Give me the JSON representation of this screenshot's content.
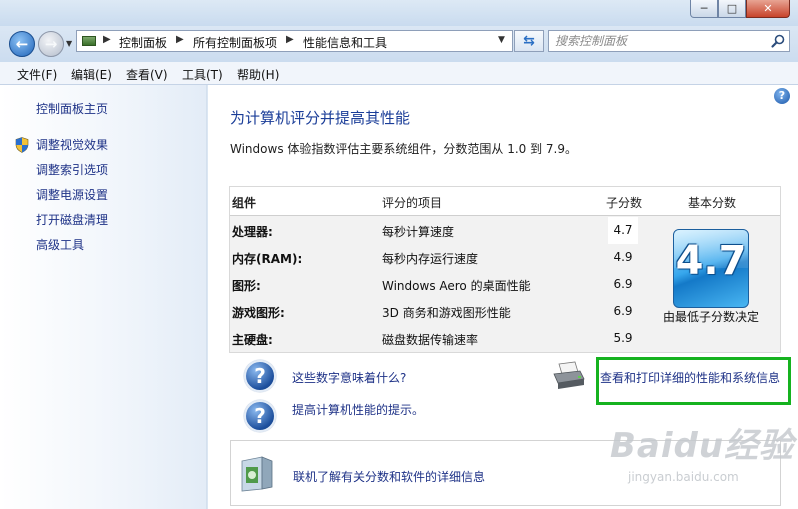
{
  "window": {
    "minimize": "─",
    "maximize": "□",
    "close": "✕"
  },
  "address": {
    "crumbs": [
      "控制面板",
      "所有控制面板项",
      "性能信息和工具"
    ]
  },
  "search": {
    "placeholder": "搜索控制面板"
  },
  "menu": [
    "文件(F)",
    "编辑(E)",
    "查看(V)",
    "工具(T)",
    "帮助(H)"
  ],
  "sidebar": {
    "home": "控制面板主页",
    "items": [
      "调整视觉效果",
      "调整索引选项",
      "调整电源设置",
      "打开磁盘清理",
      "高级工具"
    ]
  },
  "main": {
    "title": "为计算机评分并提高其性能",
    "description": "Windows 体验指数评估主要系统组件，分数范围从 1.0 到 7.9。",
    "table": {
      "headers": {
        "component": "组件",
        "rated": "评分的项目",
        "subscore": "子分数",
        "base": "基本分数"
      },
      "rows": [
        {
          "component": "处理器:",
          "item": "每秒计算速度",
          "score": "4.7"
        },
        {
          "component": "内存(RAM):",
          "item": "每秒内存运行速度",
          "score": "4.9"
        },
        {
          "component": "图形:",
          "item": "Windows Aero 的桌面性能",
          "score": "6.9"
        },
        {
          "component": "游戏图形:",
          "item": "3D 商务和游戏图形性能",
          "score": "6.9"
        },
        {
          "component": "主硬盘:",
          "item": "磁盘数据传输速率",
          "score": "5.9"
        }
      ],
      "base_score": "4.7",
      "base_caption": "由最低子分数决定"
    },
    "links": {
      "meaning": "这些数字意味着什么?",
      "tips": "提高计算机性能的提示。",
      "print": "查看和打印详细的性能和系统信息",
      "online": "联机了解有关分数和软件的详细信息"
    }
  },
  "watermark": {
    "brand": "Baidu经验",
    "url": "jingyan.baidu.com"
  },
  "colors": {
    "link": "#1e3287",
    "title": "#1a3d98",
    "highlight": "#15b21f"
  }
}
